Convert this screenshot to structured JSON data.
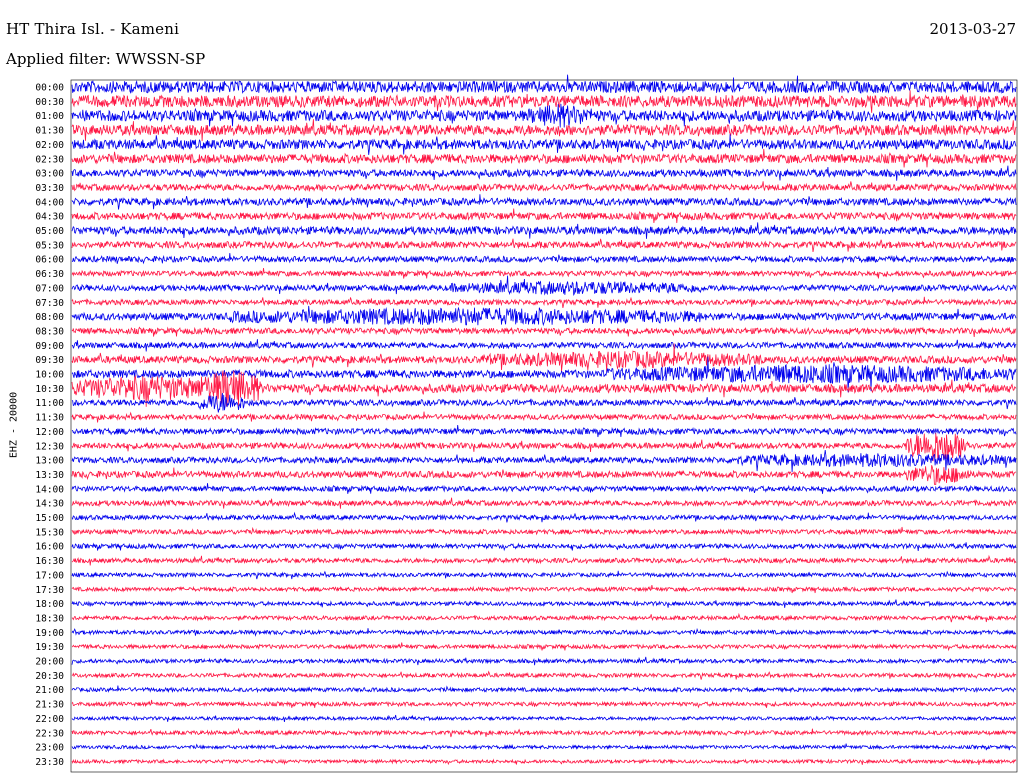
{
  "header": {
    "station": "HT Thira Isl. - Kameni",
    "date": "2013-03-27",
    "filter": "Applied filter: WWSSN-SP"
  },
  "channel_label": "EHZ - 20000",
  "colors": {
    "even_trace": "#0000ee",
    "odd_trace": "#ff1744",
    "background": "#ffffff"
  },
  "chart_data": {
    "type": "line",
    "title": "HT Thira Isl. - Kameni",
    "subtitle": "Applied filter: WWSSN-SP",
    "ylabel": "EHZ - 20000",
    "y_tick_labels": [
      "00:00",
      "00:30",
      "01:00",
      "01:30",
      "02:00",
      "02:30",
      "03:00",
      "03:30",
      "04:00",
      "04:30",
      "05:00",
      "05:30",
      "06:00",
      "06:30",
      "07:00",
      "07:30",
      "08:00",
      "08:30",
      "09:00",
      "09:30",
      "10:00",
      "10:30",
      "11:00",
      "11:30",
      "12:00",
      "12:30",
      "13:00",
      "13:30",
      "14:00",
      "14:30",
      "15:00",
      "15:30",
      "16:00",
      "16:30",
      "17:00",
      "17:30",
      "18:00",
      "18:30",
      "19:00",
      "19:30",
      "20:00",
      "20:30",
      "21:00",
      "21:30",
      "22:00",
      "22:30",
      "23:00",
      "23:30"
    ],
    "x_range_minutes": [
      0,
      30
    ],
    "trace_colors": [
      "blue",
      "red"
    ],
    "noise_level": [
      0.9,
      0.9,
      0.85,
      0.8,
      0.75,
      0.7,
      0.55,
      0.5,
      0.55,
      0.55,
      0.6,
      0.5,
      0.45,
      0.4,
      0.45,
      0.4,
      0.55,
      0.45,
      0.45,
      0.55,
      0.6,
      0.65,
      0.45,
      0.4,
      0.45,
      0.45,
      0.45,
      0.5,
      0.4,
      0.4,
      0.35,
      0.35,
      0.35,
      0.35,
      0.3,
      0.3,
      0.3,
      0.3,
      0.3,
      0.3,
      0.3,
      0.3,
      0.3,
      0.3,
      0.25,
      0.3,
      0.25,
      0.25
    ],
    "events": [
      {
        "row": "01:00",
        "start_min": 14.5,
        "end_min": 16.5,
        "amplitude": 1.3
      },
      {
        "row": "07:00",
        "start_min": 12.0,
        "end_min": 20.0,
        "amplitude": 1.2
      },
      {
        "row": "08:00",
        "start_min": 5.0,
        "end_min": 20.0,
        "amplitude": 1.4
      },
      {
        "row": "09:30",
        "start_min": 13.0,
        "end_min": 22.0,
        "amplitude": 1.3
      },
      {
        "row": "10:00",
        "start_min": 17.0,
        "end_min": 30.0,
        "amplitude": 1.4
      },
      {
        "row": "10:30",
        "start_min": 0.0,
        "end_min": 5.0,
        "amplitude": 1.8
      },
      {
        "row": "10:30",
        "start_min": 4.0,
        "end_min": 6.0,
        "amplitude": 3.0
      },
      {
        "row": "11:00",
        "start_min": 4.0,
        "end_min": 5.5,
        "amplitude": 2.0
      },
      {
        "row": "12:30",
        "start_min": 26.5,
        "end_min": 28.5,
        "amplitude": 3.5
      },
      {
        "row": "13:00",
        "start_min": 21.0,
        "end_min": 30.0,
        "amplitude": 1.2
      },
      {
        "row": "13:30",
        "start_min": 26.5,
        "end_min": 28.5,
        "amplitude": 1.8
      }
    ]
  }
}
